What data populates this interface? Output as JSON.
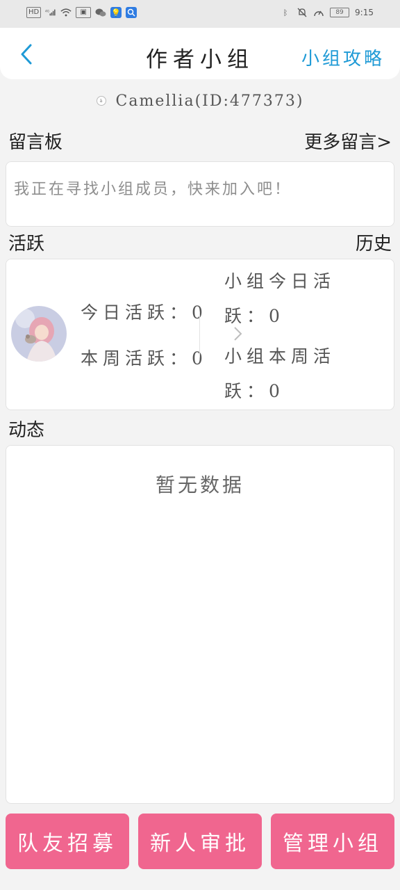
{
  "status_bar": {
    "network": "HD",
    "signal": "4G",
    "battery": "89",
    "time": "9:15"
  },
  "nav": {
    "title": "作者小组",
    "right_link": "小组攻略"
  },
  "user": {
    "avatar_text": "ä",
    "name": "Camellia(ID:477373)"
  },
  "board": {
    "label": "留言板",
    "more": "更多留言>",
    "message": "我正在寻找小组成员，快来加入吧！"
  },
  "activity": {
    "label": "活跃",
    "history": "历史",
    "today_label": "今日活跃：",
    "today_value": "0",
    "week_label": "本周活跃：",
    "week_value": "0",
    "group_today_label_a": "小组今日活",
    "group_today_label_b": "跃：",
    "group_today_value": "0",
    "group_week_label_a": "小组本周活",
    "group_week_label_b": "跃：",
    "group_week_value": "0"
  },
  "feed": {
    "label": "动态",
    "empty": "暂无数据"
  },
  "actions": {
    "recruit": "队友招募",
    "review": "新人审批",
    "manage": "管理小组"
  },
  "colors": {
    "accent_blue": "#1e9ad6",
    "button_pink": "#f0668f"
  }
}
